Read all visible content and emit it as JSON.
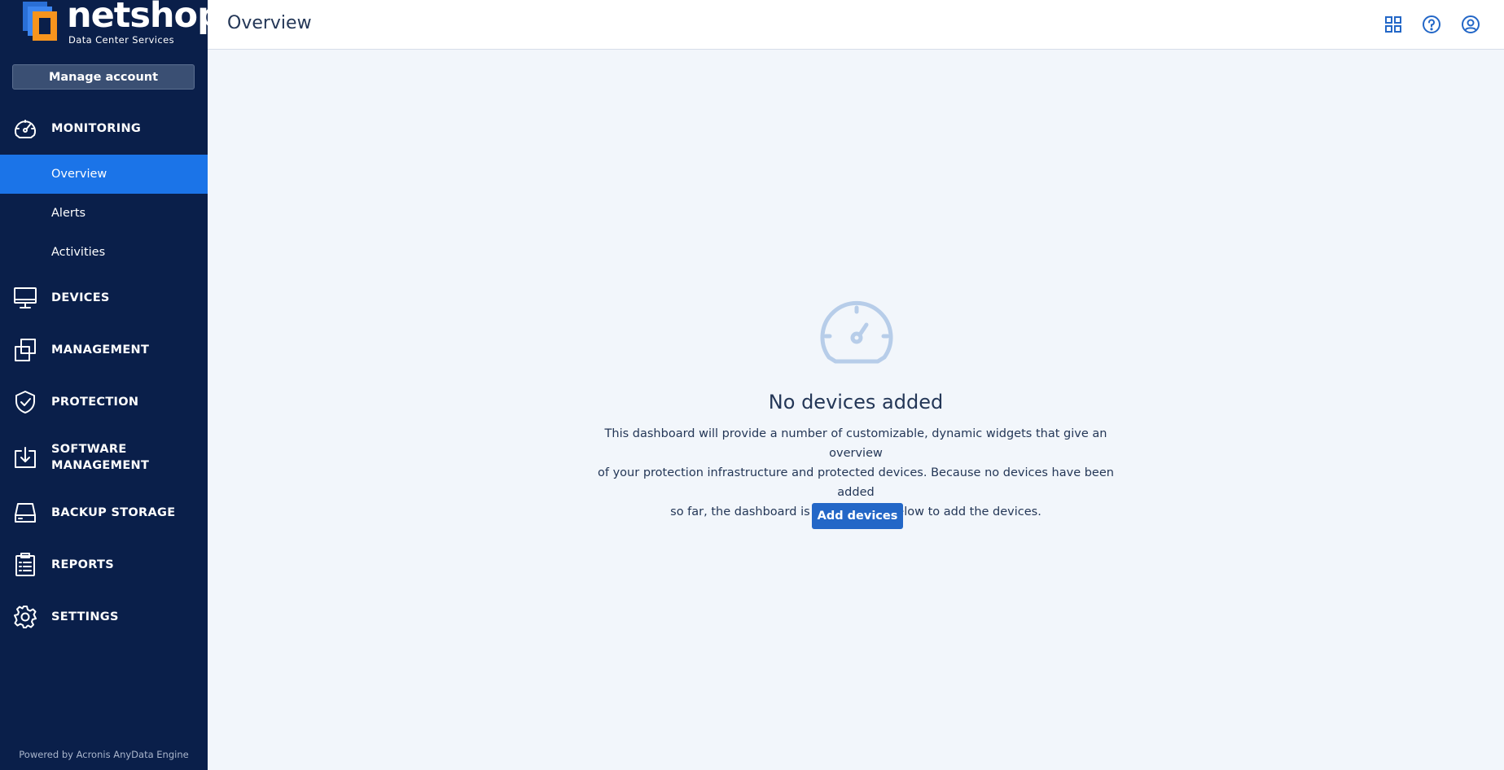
{
  "brand": {
    "name": "netshop",
    "tagline": "Data Center Services"
  },
  "sidebar": {
    "manage_account": "Manage account",
    "sections": {
      "monitoring": "MONITORING",
      "devices": "DEVICES",
      "management": "MANAGEMENT",
      "protection": "PROTECTION",
      "software_management_line1": "SOFTWARE",
      "software_management_line2": "MANAGEMENT",
      "backup_storage": "BACKUP STORAGE",
      "reports": "REPORTS",
      "settings": "SETTINGS"
    },
    "monitoring_items": {
      "overview": "Overview",
      "alerts": "Alerts",
      "activities": "Activities"
    },
    "footer": "Powered by Acronis AnyData Engine"
  },
  "header": {
    "title": "Overview",
    "icons": [
      "grid-icon",
      "help-icon",
      "user-icon"
    ]
  },
  "main": {
    "heading": "No devices added",
    "description_line1": "This dashboard will provide a number of customizable, dynamic widgets that give an overview",
    "description_line2": "of your protection infrastructure and protected devices. Because no devices have been added",
    "description_line3": "so far, the dashboard is empty. Click below to add the devices.",
    "add_button": "Add devices"
  },
  "colors": {
    "sidebar_bg": "#0a1f4a",
    "active_item": "#1b74e8",
    "primary_button": "#2367c7",
    "content_bg": "#f2f6fb",
    "logo_orange": "#f7941d",
    "logo_blue": "#2a6fd6"
  }
}
